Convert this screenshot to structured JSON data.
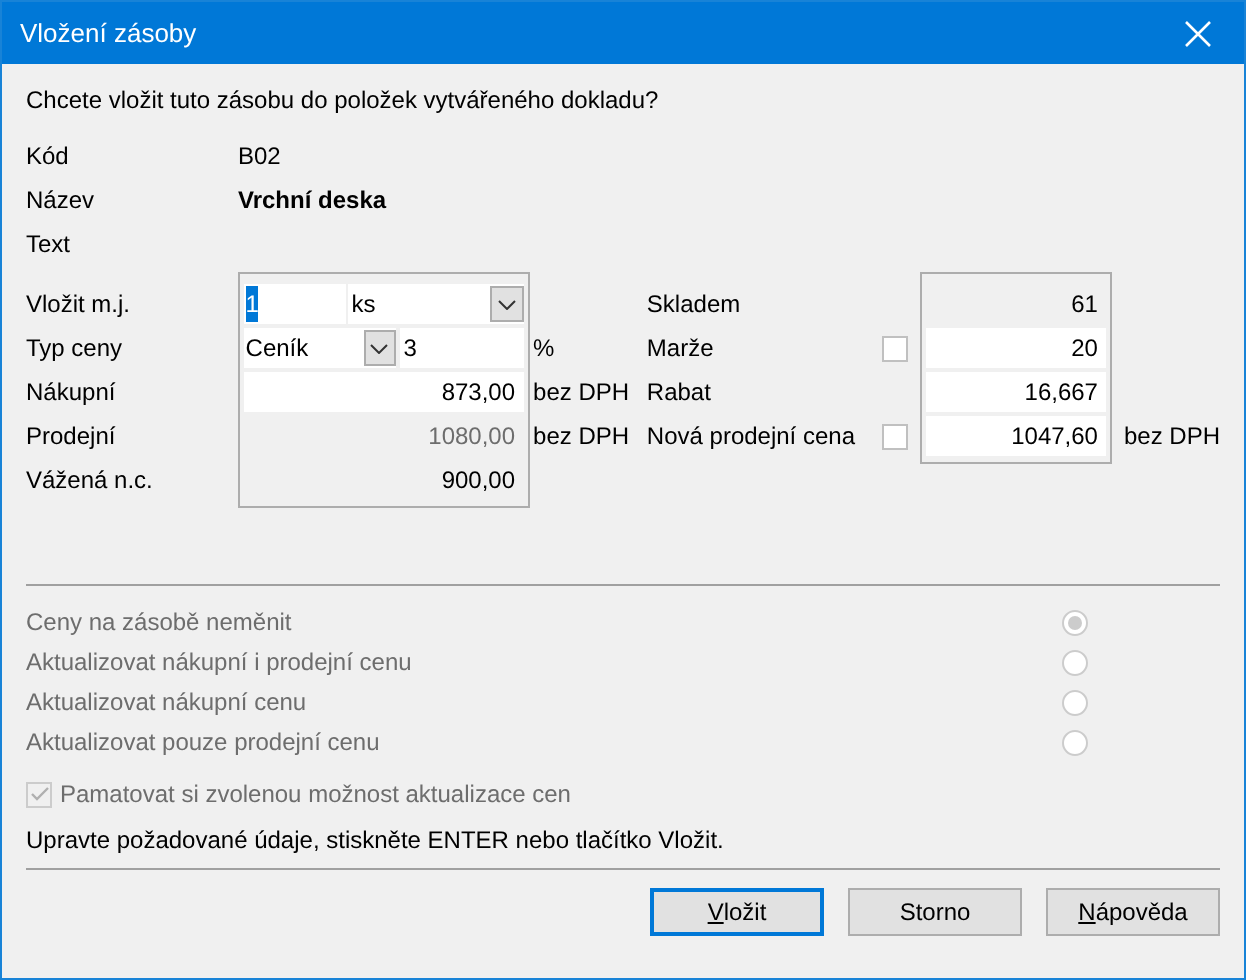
{
  "window": {
    "title": "Vložení zásoby"
  },
  "question": "Chcete vložit tuto zásobu do položek vytvářeného dokladu?",
  "info": [
    {
      "label": "Kód",
      "value": "B02",
      "bold": false
    },
    {
      "label": "Název",
      "value": "Vrchní deska",
      "bold": true
    },
    {
      "label": "Text"
    }
  ],
  "left_rows": [
    {
      "kind": "quantity",
      "label": "Vložit m.j.",
      "value": "1",
      "text_selected": true,
      "unit_value": "ks"
    },
    {
      "kind": "price_type",
      "label": "Typ ceny",
      "value": "Ceník",
      "percent": "3",
      "unit": "%"
    },
    {
      "kind": "field",
      "label": "Nákupní",
      "value": "873,00",
      "unit": "bez DPH"
    },
    {
      "kind": "disabled",
      "label": "Prodejní",
      "value": "1080,00",
      "unit": "bez DPH"
    },
    {
      "kind": "readonly",
      "label": "Vážená n.c.",
      "value": "900,00"
    }
  ],
  "right_rows": [
    {
      "kind": "readonly",
      "label": "Skladem",
      "value": "61"
    },
    {
      "kind": "field",
      "label": "Marže",
      "value": "20",
      "checked": false
    },
    {
      "kind": "field",
      "label": "Rabat",
      "value": "16,667"
    },
    {
      "kind": "field",
      "label": "Nová prodejní cena",
      "value": "1047,60",
      "checked": false,
      "unit": "bez DPH"
    }
  ],
  "update_options": [
    {
      "label": "Ceny na zásobě neměnit",
      "selected": true,
      "disabled": true
    },
    {
      "label": "Aktualizovat nákupní i prodejní cenu",
      "selected": false,
      "disabled": true
    },
    {
      "label": "Aktualizovat nákupní cenu",
      "selected": false,
      "disabled": true
    },
    {
      "label": "Aktualizovat pouze prodejní cenu",
      "selected": false,
      "disabled": true
    }
  ],
  "remember": {
    "label": "Pamatovat si zvolenou možnost aktualizace cen",
    "checked": true,
    "disabled": true
  },
  "hint": "Upravte požadované údaje, stiskněte ENTER nebo tlačítko Vložit.",
  "buttons": [
    {
      "label": "Vložit",
      "default": true,
      "mnemonic": true
    },
    {
      "label": "Storno",
      "default": false,
      "mnemonic": false
    },
    {
      "label": "Nápověda",
      "default": false,
      "mnemonic": true
    }
  ]
}
